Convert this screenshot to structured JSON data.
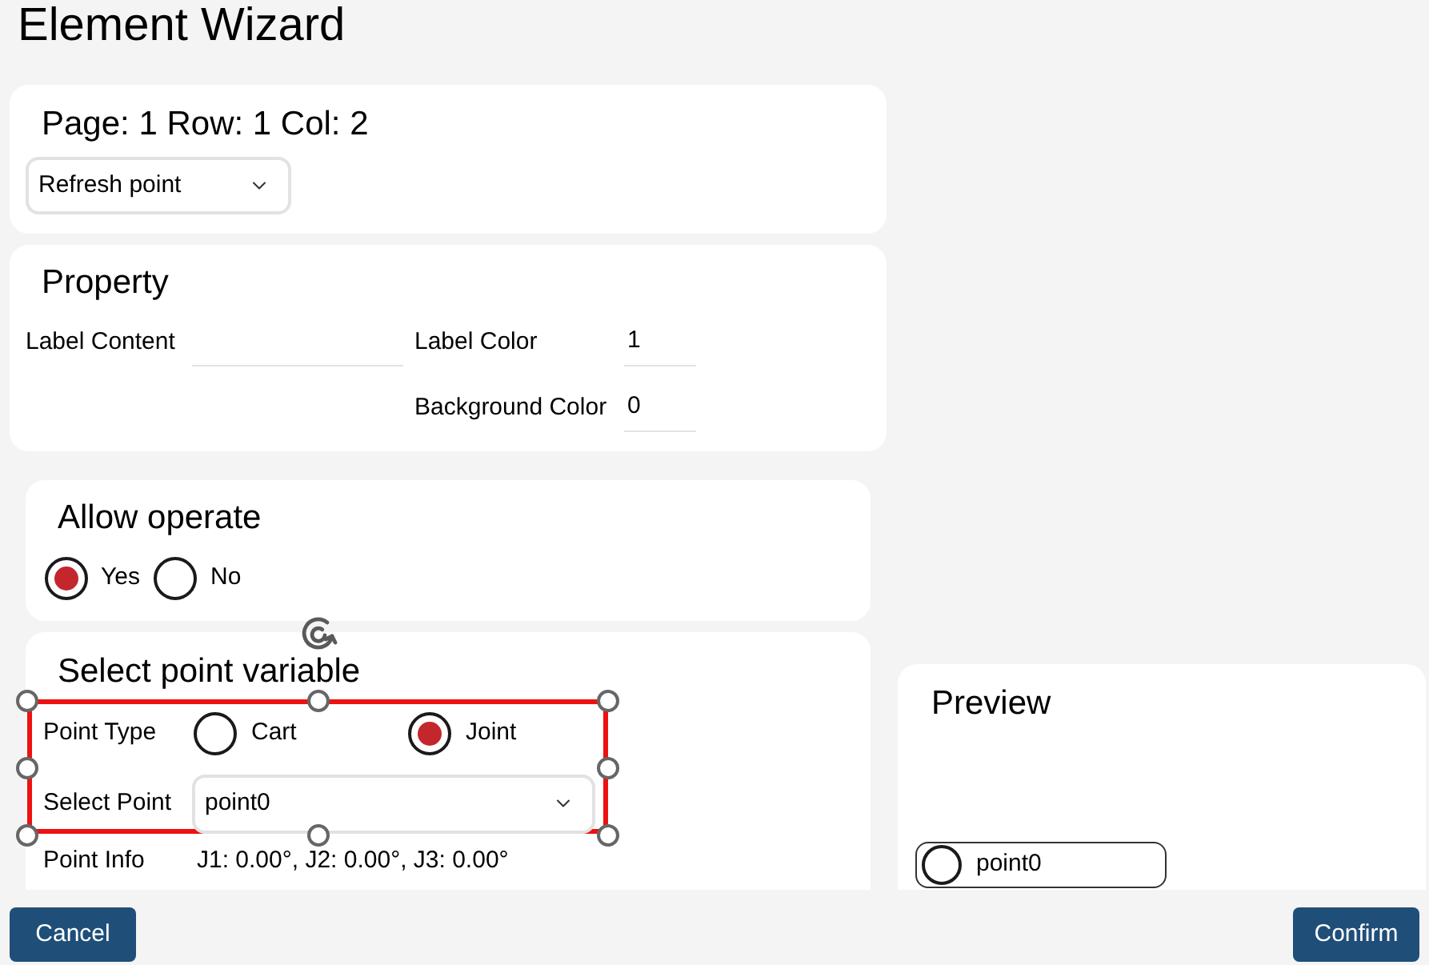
{
  "title": "Element Wizard",
  "location": {
    "text": "Page: 1 Row: 1 Col: 2",
    "action": {
      "value": "Refresh point"
    }
  },
  "property": {
    "title": "Property",
    "fields": [
      {
        "label": "Label Content"
      },
      {
        "label": "Label Color",
        "value": "1"
      },
      {
        "label": "Background Color",
        "value": "0"
      }
    ]
  },
  "allow_operate": {
    "title": "Allow operate",
    "options": [
      {
        "label": "Yes",
        "selected": true
      },
      {
        "label": "No",
        "selected": false
      }
    ]
  },
  "point_variable": {
    "title": "Select point variable",
    "selected": true,
    "point_type": {
      "label": "Point Type",
      "options": [
        {
          "label": "Cart",
          "selected": false
        },
        {
          "label": "Joint",
          "selected": true
        }
      ]
    },
    "select_point": {
      "label": "Select Point",
      "value": "point0"
    },
    "point_info": {
      "label": "Point Info",
      "value": "J1: 0.00°, J2: 0.00°, J3: 0.00°"
    }
  },
  "preview": {
    "title": "Preview",
    "widget": {
      "label": "point0",
      "checked": false
    }
  },
  "buttons": [
    {
      "label": "Cancel"
    },
    {
      "label": "Confirm"
    }
  ]
}
